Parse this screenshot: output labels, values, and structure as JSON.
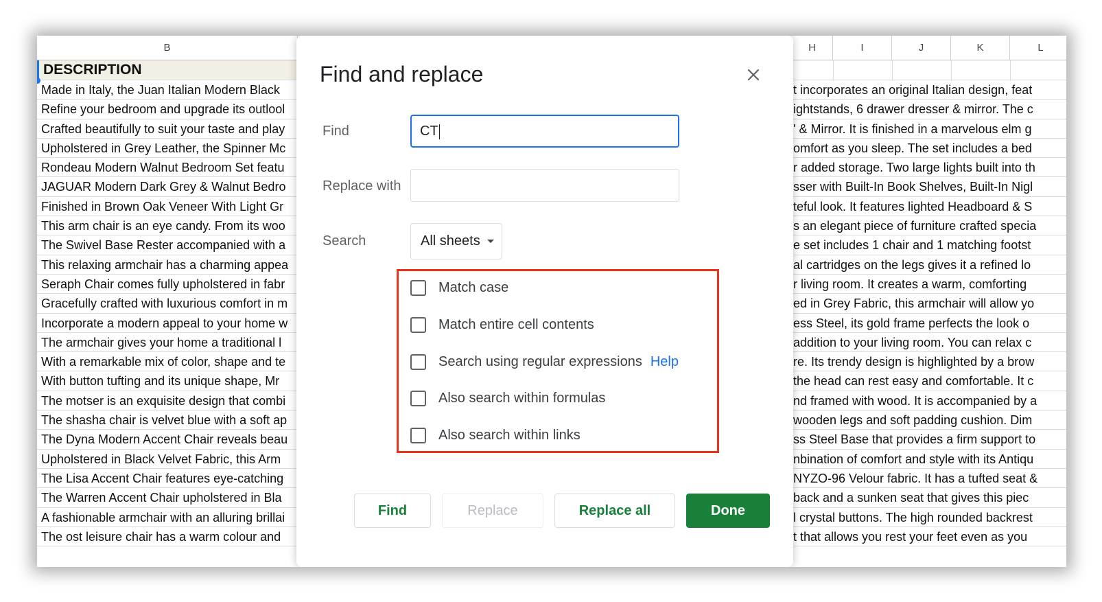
{
  "sheet": {
    "col_b": "B",
    "right_cols": [
      "H",
      "I",
      "J",
      "K",
      "L"
    ],
    "header_cell": "DESCRIPTION",
    "left_rows": [
      "Made in Italy, the Juan Italian Modern Black",
      "Refine your bedroom and upgrade its outlool",
      "Crafted beautifully to suit your taste and play",
      "Upholstered in Grey Leather, the Spinner Mc",
      "Rondeau Modern Walnut Bedroom Set featu",
      "JAGUAR Modern Dark Grey & Walnut Bedro",
      "Finished in Brown Oak Veneer With Light Gr",
      "This arm chair is an eye candy. From its woo",
      "The Swivel Base Rester accompanied with a",
      "This relaxing armchair has a charming appea",
      "Seraph Chair comes fully upholstered in fabr",
      "Gracefully crafted with luxurious comfort in m",
      "Incorporate a modern appeal to your home w",
      "The armchair gives your home a traditional l",
      "With a remarkable mix of color, shape and te",
      "With button tufting and its unique shape, Mr",
      "The motser is an exquisite design that combi",
      "The shasha chair is velvet blue with a soft ap",
      "The Dyna Modern Accent Chair reveals beau",
      "Upholstered in Black Velvet Fabric, this Arm",
      "The Lisa Accent Chair features eye-catching",
      "The Warren Accent Chair upholstered in Bla",
      "A fashionable armchair with an alluring brillai",
      "The ost leisure chair has a warm colour and"
    ],
    "right_rows": [
      "t incorporates an original Italian design, feat",
      "ightstands, 6 drawer dresser & mirror. The c",
      "' & Mirror. It is finished in a marvelous elm g",
      "omfort as you sleep. The set includes a bed",
      "r added storage. Two large lights built into th",
      "sser with Built-In Book Shelves, Built-In Nigl",
      "teful look. It features lighted Headboard & S",
      "s an elegant piece of furniture crafted specia",
      "e set includes 1 chair and 1 matching footst",
      "al cartridges on the legs gives it a refined lo",
      "r living room. It creates a warm, comforting",
      "ed in Grey Fabric, this armchair will allow yo",
      "ess Steel, its gold frame perfects the look o",
      "addition to your living room. You can relax c",
      "re. Its trendy design is highlighted by a brow",
      "the head can rest easy and comfortable. It c",
      "nd framed with wood. It is accompanied by a",
      "wooden legs and soft padding cushion. Dim",
      "ss Steel Base that provides a firm support to",
      "nbination of comfort and style with its Antiqu",
      "NYZO-96 Velour fabric. It has a tufted seat &",
      "back and a sunken seat that gives this piec",
      "l crystal buttons. The high rounded backrest",
      "t that allows you rest your feet even as you"
    ]
  },
  "dialog": {
    "title": "Find and replace",
    "find_label": "Find",
    "find_value": "CT",
    "replace_label": "Replace with",
    "replace_value": "",
    "search_label": "Search",
    "search_value": "All sheets",
    "options": [
      {
        "label": "Match case",
        "checked": false
      },
      {
        "label": "Match entire cell contents",
        "checked": false
      },
      {
        "label": "Search using regular expressions",
        "checked": false
      },
      {
        "label": "Also search within formulas",
        "checked": false
      },
      {
        "label": "Also search within links",
        "checked": false
      }
    ],
    "help_link": "Help",
    "buttons": {
      "find": "Find",
      "replace": "Replace",
      "replace_all": "Replace all",
      "done": "Done"
    },
    "colors": {
      "accent": "#1a73e8",
      "primary": "#188038",
      "highlight": "#e8341c"
    }
  }
}
